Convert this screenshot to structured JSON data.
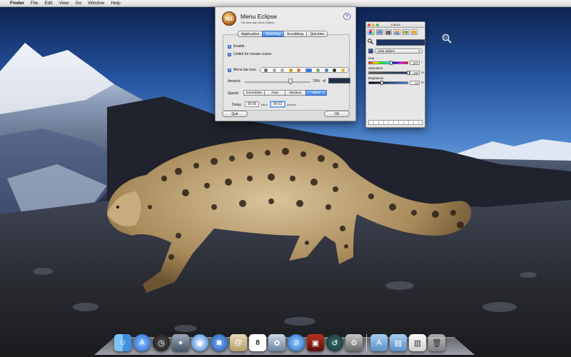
{
  "menubar": {
    "apple": "",
    "items": [
      "Finder",
      "File",
      "Edit",
      "View",
      "Go",
      "Window",
      "Help"
    ]
  },
  "menu_eclipse": {
    "logo": "ME",
    "title": "Menu Eclipse",
    "subtitle": "The Mac App Store Edition",
    "help": "?",
    "tabs": [
      "Application",
      "Dimming",
      "Scrubbing",
      "Quickies"
    ],
    "selected_tab": "Dimming",
    "enable_label": "Enable",
    "undim_label": "Undim for mouse cursor",
    "menubar_icon_label": "Menu bar icon",
    "amount_label": "Amount:",
    "amount_value": "70%",
    "amount_fraction": 0.7,
    "amount_of": "of",
    "dim_color": "#1f2e4c",
    "speed_label": "Speed:",
    "speed_options": [
      "Immediate",
      "Fast",
      "Medium",
      "Slow"
    ],
    "speed_selected": "Slow",
    "delay_label": "Delay:",
    "delay_value": "00:05",
    "delay_value_unit": "(dim)",
    "undim_value": "00:02",
    "undim_value_unit": "(undim)",
    "quit_label": "Quit",
    "ok_label": "OK"
  },
  "colors_panel": {
    "title": "Colors",
    "mode": "HSB Sliders",
    "current_color": "#1c3561",
    "hue_label": "Hue",
    "hue_value": "207",
    "hue_unit": "°",
    "saturation_label": "Saturation",
    "saturation_value": "100",
    "saturation_unit": "%",
    "brightness_label": "Brightness",
    "brightness_value": "34",
    "brightness_unit": "%",
    "hue_fraction": 0.575,
    "saturation_fraction": 1.0,
    "brightness_fraction": 0.34
  },
  "dock": {
    "date_number": "8",
    "apps": [
      "Finder",
      "Dashboard",
      "Safari",
      "Preview",
      "Mail",
      "iCal",
      "iTunes",
      "Time Machine",
      "System Preferences",
      "Applications",
      "Documents",
      "Trash"
    ]
  }
}
